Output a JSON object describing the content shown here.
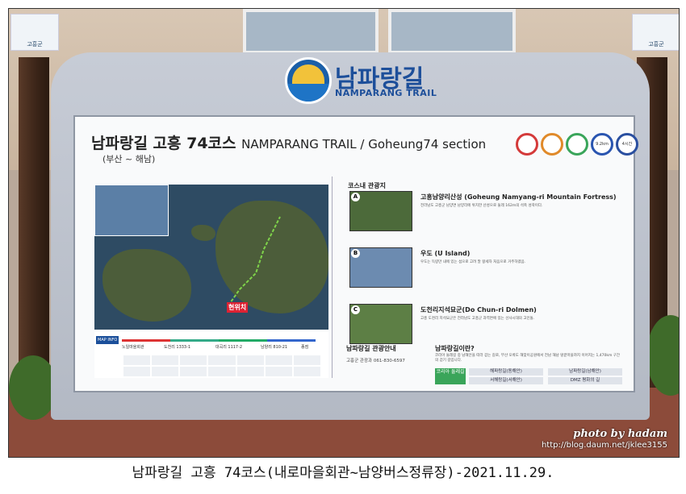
{
  "sign": {
    "logo_title": "남파랑길",
    "logo_subtitle": "NAMPARANG TRAIL",
    "heading_ko": "남파랑길 고흥 74코스",
    "heading_en": "NAMPARANG TRAIL / Goheung74 section",
    "heading_sub": "(부산 ~ 해남)",
    "badges": [
      "",
      "",
      "",
      "9.2km",
      "4시간"
    ],
    "badge_colors": [
      "#d43a3a",
      "#e08a2a",
      "#3aa55a",
      "#2a55b0",
      "#2a4fa0"
    ],
    "map_here": "현위치",
    "route_info": "MAP INFO",
    "route_stops": [
      "노일마을회관",
      "도천리 1333-1",
      "대곡리 1117-2",
      "남양리 810-21",
      "종점"
    ],
    "section_title": "코스내 관광지",
    "attractions": [
      {
        "letter": "A",
        "name": "고흥남양리산성 (Goheung Namyang-ri Mountain Fortress)",
        "desc": "전라남도 고흥군 남양면 남양리에 위치한 산성으로 둘레 162m의 석축 성곽이다.",
        "color": "#4c6a3a"
      },
      {
        "letter": "B",
        "name": "우도 (U Island)",
        "desc": "우도는 득량만 내에 있는 섬으로 고려 말 왕세자 처음으로 거주하였음.",
        "color": "#6c8bb0"
      },
      {
        "letter": "C",
        "name": "도천리지석묘군(Do Chun-ri Dolmen)",
        "desc": "고흥 도천리 지석묘군은 전라남도 고흥군 과역면에 있는 선사시대의 고인돌.",
        "color": "#5d7f45"
      }
    ],
    "info_left_title": "남파랑길 관광안내",
    "info_tel": "고흥군 관광과   061-830-6597",
    "info_right_title": "남파랑길이란?",
    "info_right_desc": "코리아 둘레길 중 남해안을 따라 걷는 길로, 부산 오륙도 해맞이공원에서 전남 해남 땅끝마을까지 이어지는 1,470km 구간의 걷기 길입니다.",
    "korea_btn": "코리아 둘레길",
    "ways": [
      "해파랑길(동해안)",
      "서해랑길(서해안)",
      "남파랑길(남해안)",
      "DMZ 평화의 길"
    ]
  },
  "post_labels": [
    "고흥군",
    "고흥군"
  ],
  "watermark_by": "photo by hadam",
  "watermark_url": "http://blog.daum.net/jklee3155",
  "caption": "남파랑길 고흥 74코스(내로마을회관~남양버스정류장)-2021.11.29."
}
